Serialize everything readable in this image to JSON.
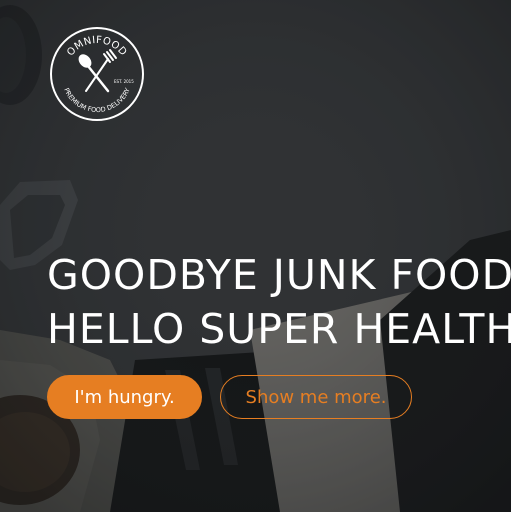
{
  "logo": {
    "brand": "OMNIFOOD",
    "tagline": "PREMIUM FOOD DELIVERY",
    "est": "EST. 2015"
  },
  "hero": {
    "line1": "GOODBYE JUNK FOOD.",
    "line2": "HELLO SUPER HEALTHY MEALS."
  },
  "buttons": {
    "primary": "I'm hungry.",
    "secondary": "Show me more."
  },
  "colors": {
    "accent": "#e67e22",
    "overlay": "#3a3d40",
    "text": "#ffffff"
  }
}
